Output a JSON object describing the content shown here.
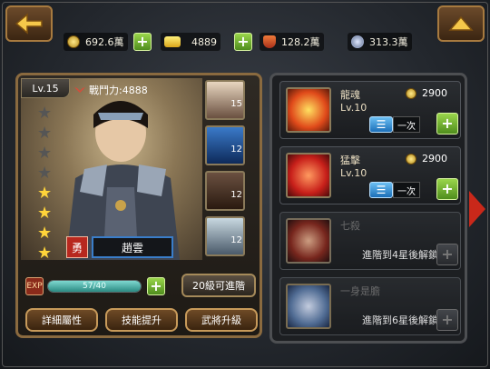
{
  "resources": {
    "coins": "692.6萬",
    "ingots": "4889",
    "shield": "128.2萬",
    "crystal": "313.3萬"
  },
  "hero": {
    "level": "Lv.15",
    "power": "戰鬥力:4888",
    "name": "趙雲",
    "badge": "勇",
    "stars_filled": 4,
    "stars_total": 8,
    "exp_text": "57/40",
    "exp_fraction": 1.0,
    "advance_label": "20級可進階"
  },
  "thumbs": [
    {
      "num": "15"
    },
    {
      "num": "12"
    },
    {
      "num": "12"
    },
    {
      "num": "12"
    }
  ],
  "buttons": {
    "detail": "詳細屬性",
    "skill_up": "技能提升",
    "general_up": "武將升級",
    "back": "back",
    "plus": "+"
  },
  "skills": [
    {
      "name": "龍魂",
      "level": "Lv.10",
      "cost": "2900",
      "once": "一次",
      "locked": false
    },
    {
      "name": "猛擊",
      "level": "Lv.10",
      "cost": "2900",
      "once": "一次",
      "locked": false
    },
    {
      "name": "七殺",
      "level": "",
      "lock_text": "進階到4星後解鎖",
      "locked": true
    },
    {
      "name": "一身是膽",
      "level": "",
      "lock_text": "進階到6星後解鎖",
      "locked": true
    }
  ],
  "colors": {
    "accent_gold": "#a77a3f",
    "green_button": "#6bb333",
    "blue_button": "#1c6fb8",
    "name_border": "#3a7dc9"
  }
}
